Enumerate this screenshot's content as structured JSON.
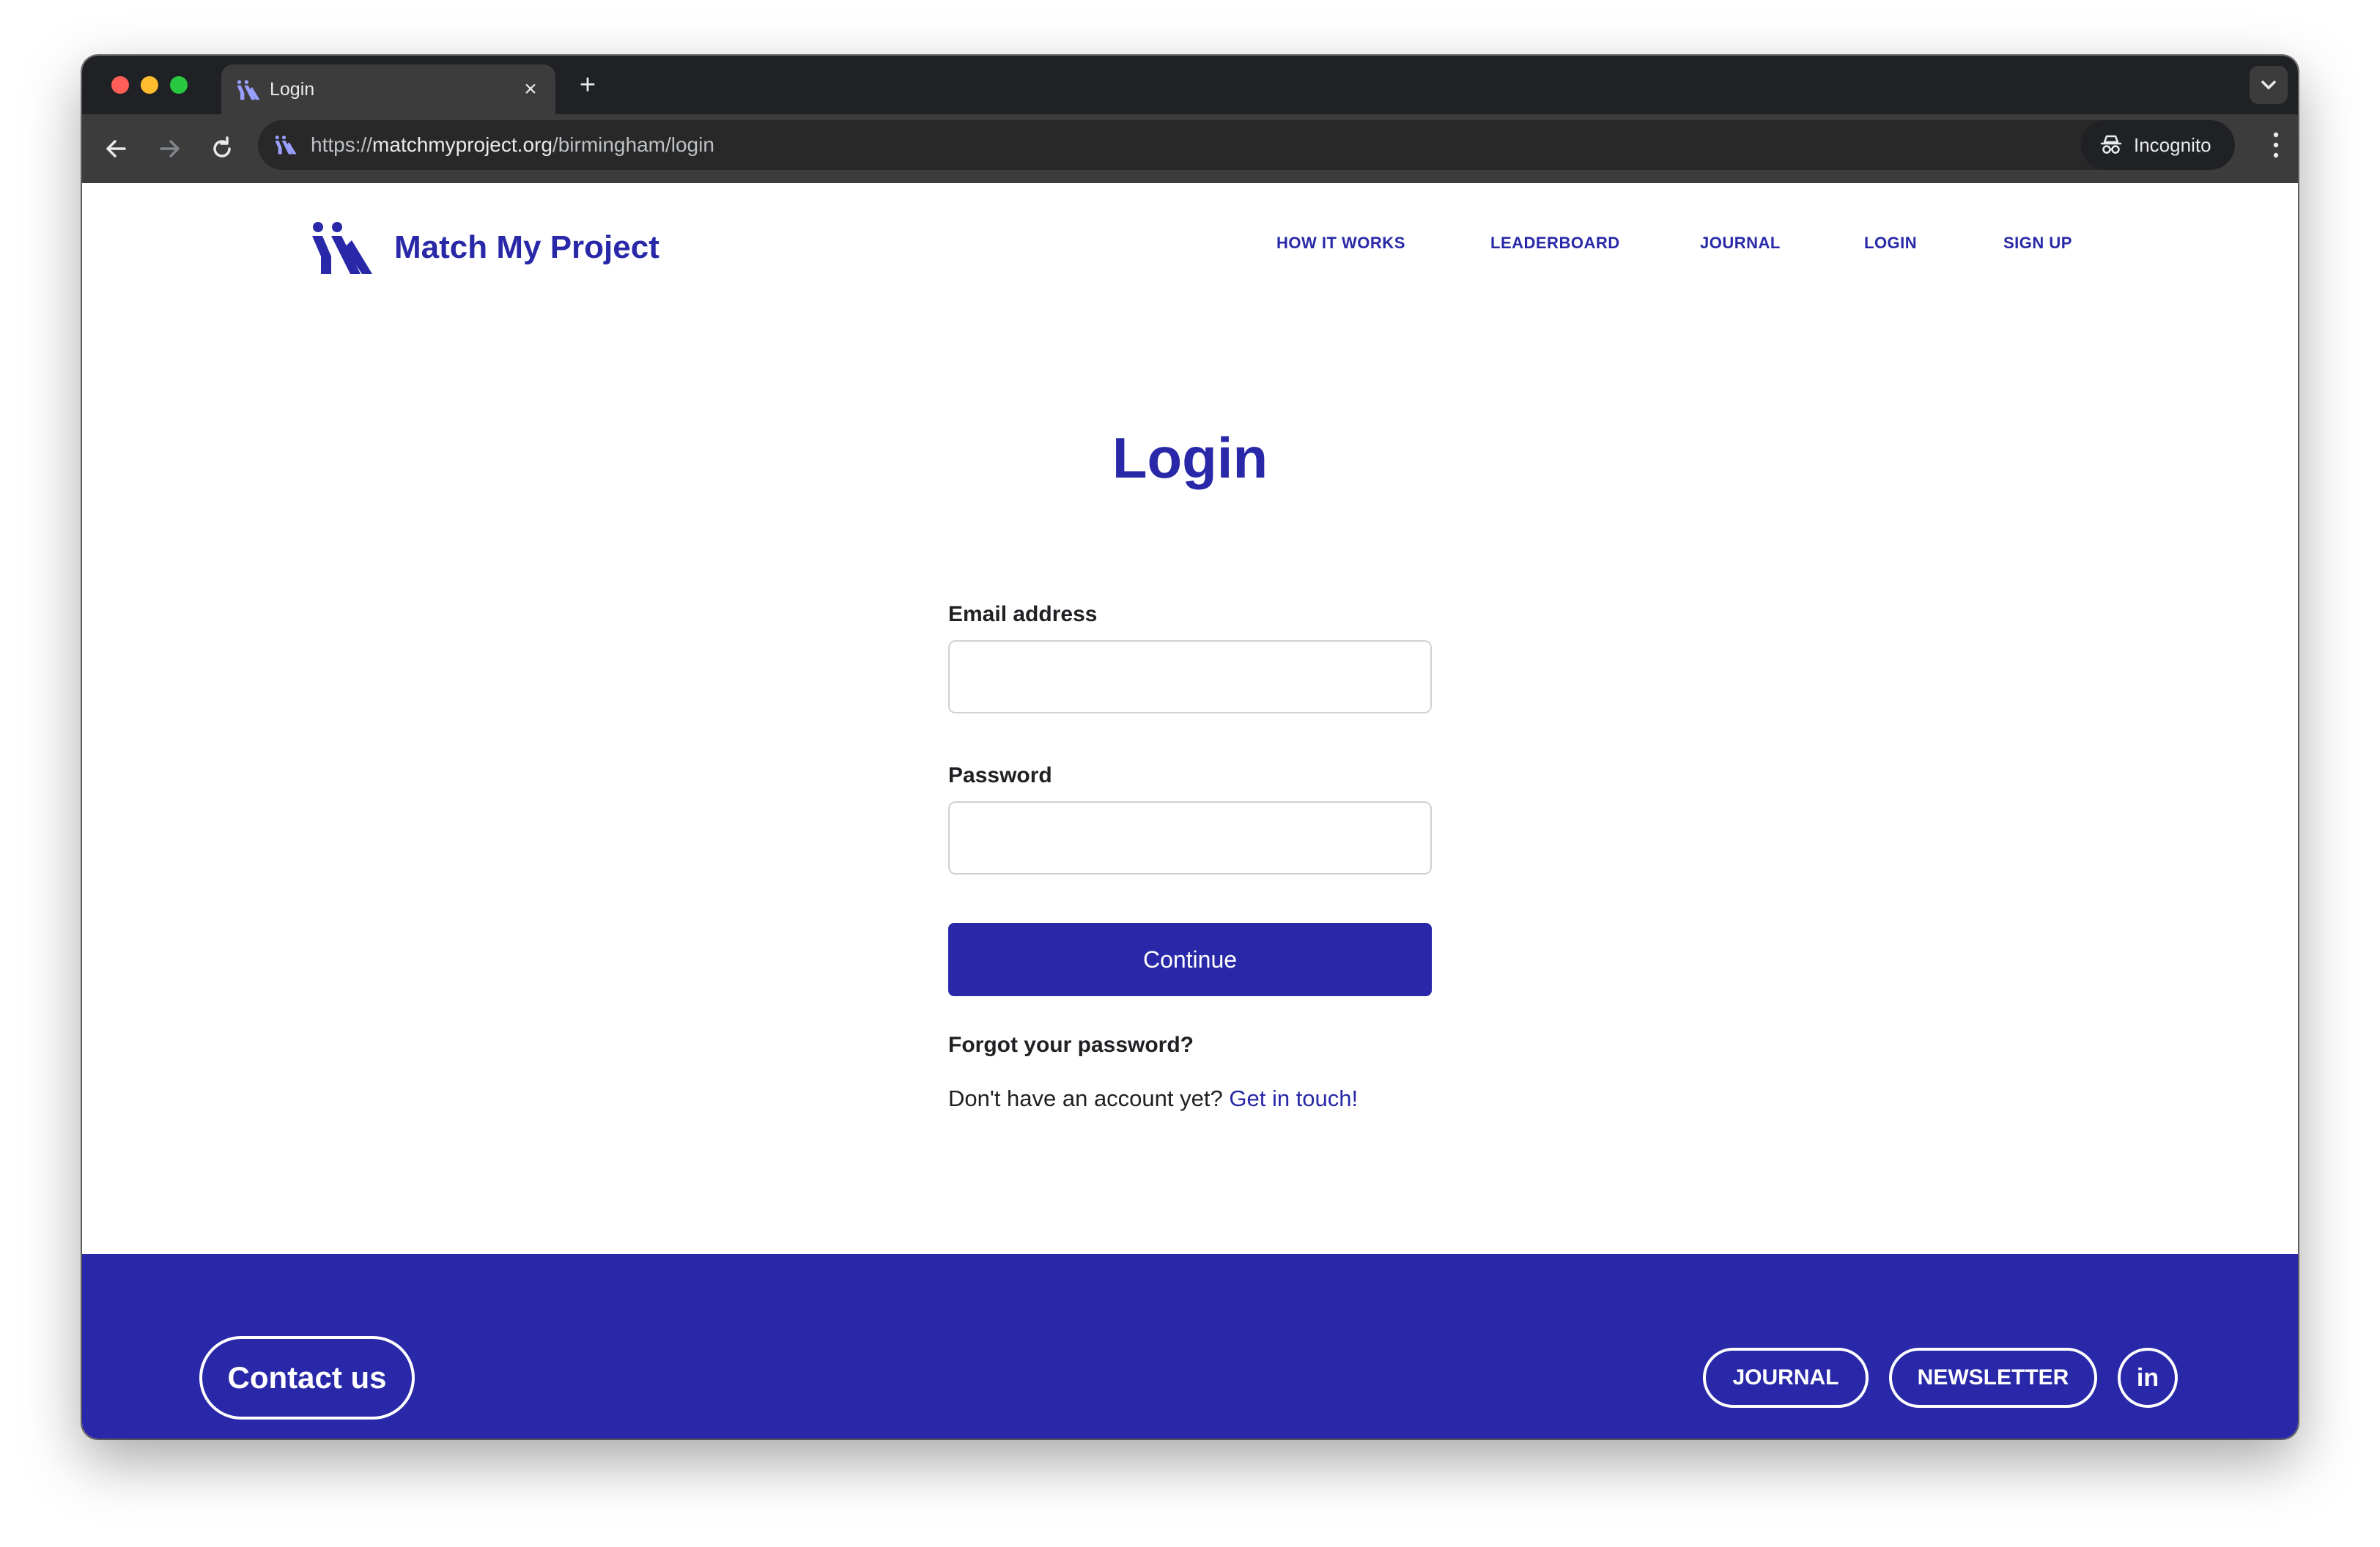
{
  "browser": {
    "tab": {
      "title": "Login",
      "close_glyph": "×"
    },
    "new_tab_glyph": "+",
    "url": {
      "scheme": "https://",
      "host": "matchmyproject.org",
      "path": "/birmingham/login"
    },
    "incognito_label": "Incognito",
    "icons": [
      "back-arrow-icon",
      "forward-arrow-icon",
      "reload-icon",
      "incognito-icon",
      "kebab-menu-icon",
      "chevron-down-icon"
    ]
  },
  "site": {
    "brand": "Match My Project",
    "nav": [
      "HOW IT WORKS",
      "LEADERBOARD",
      "JOURNAL",
      "LOGIN",
      "SIGN UP"
    ],
    "accent_color": "#2828a8"
  },
  "form": {
    "title": "Login",
    "email_label": "Email address",
    "email_value": "",
    "password_label": "Password",
    "password_value": "",
    "submit_label": "Continue",
    "forgot_label": "Forgot your password?",
    "no_account_text": "Don't have an account yet?",
    "get_in_touch_label": "Get in touch!"
  },
  "footer": {
    "contact_label": "Contact us",
    "journal_label": "JOURNAL",
    "newsletter_label": "NEWSLETTER",
    "linkedin_label": "in"
  }
}
